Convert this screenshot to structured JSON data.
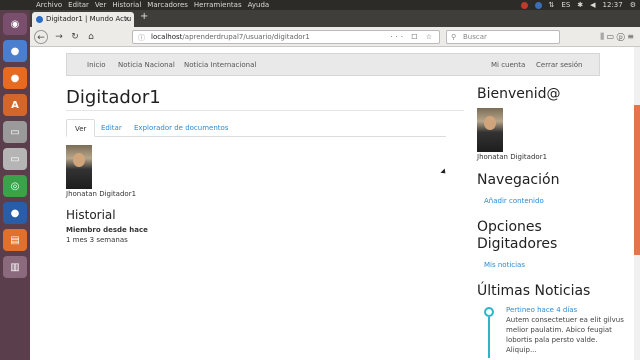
{
  "system": {
    "menu": [
      "Archivo",
      "Editar",
      "Ver",
      "Historial",
      "Marcadores",
      "Herramientas",
      "Ayuda"
    ],
    "keyboard": "ES",
    "time": "12:37"
  },
  "launcher": {
    "apps": [
      "ubuntu-icon",
      "chrome-icon",
      "firefox-icon",
      "software-center-icon",
      "files-icon",
      "drive-icon",
      "globe-icon",
      "chrome-alt-icon",
      "presentation-icon",
      "trash-icon"
    ]
  },
  "browser": {
    "tab_title": "Digitador1 | Mundo Actu",
    "tab_close": "×",
    "new_tab": "+",
    "url_host": "localhost",
    "url_path": "/aprenderdrupal7/usuario/digitador1",
    "url_actions": "··· ☐ ☆",
    "search_placeholder": "Buscar",
    "tools": "⫼ ▭ ⓟ ≡"
  },
  "site": {
    "nav_left": [
      "Inicio",
      "Noticia Nacional",
      "Noticia Internacional"
    ],
    "nav_right": [
      "Mi cuenta",
      "Cerrar sesión"
    ],
    "page_title": "Digitador1",
    "tabs": [
      "Ver",
      "Editar",
      "Explorador de documentos"
    ],
    "user_name": "Jhonatan Digitador1",
    "history_heading": "Historial",
    "member_label": "Miembro desde hace",
    "member_value": "1 mes 3 semanas"
  },
  "sidebar": {
    "welcome_heading": "Bienvenid@",
    "welcome_name": "Jhonatan Digitador1",
    "nav_heading": "Navegación",
    "nav_link": "Añadir contenido",
    "options_heading": "Opciones Digitadores",
    "options_link": "Mis noticias",
    "news_heading": "Últimas Noticias",
    "news_date": "Pertineo hace 4 días",
    "news_text": "Autem consectetuer ea elit gilvus melior paulatim. Abico feugiat lobortis pala persto valde. Aliquip..."
  }
}
